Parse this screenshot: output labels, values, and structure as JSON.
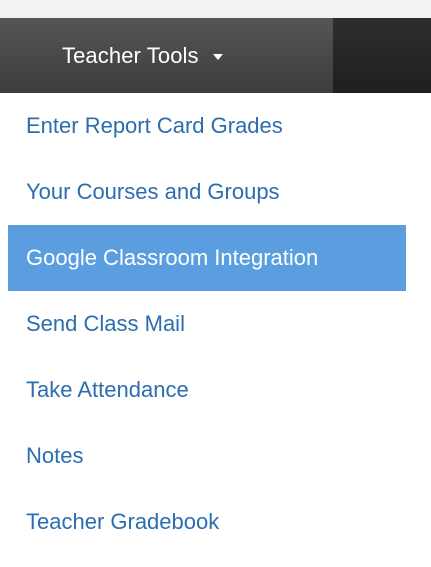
{
  "navbar": {
    "dropdown_label": "Teacher Tools",
    "dropdown_icon": "caret-down-icon"
  },
  "menu": {
    "items": [
      {
        "label": "Enter Report Card Grades",
        "active": false
      },
      {
        "label": "Your Courses and Groups",
        "active": false
      },
      {
        "label": "Google Classroom Integration",
        "active": true
      },
      {
        "label": "Send Class Mail",
        "active": false
      },
      {
        "label": "Take Attendance",
        "active": false
      },
      {
        "label": "Notes",
        "active": false
      },
      {
        "label": "Teacher Gradebook",
        "active": false
      }
    ]
  },
  "colors": {
    "link": "#2c6db0",
    "active_bg": "#5a9ee0",
    "navbar_bg": "#3d3d3d"
  }
}
